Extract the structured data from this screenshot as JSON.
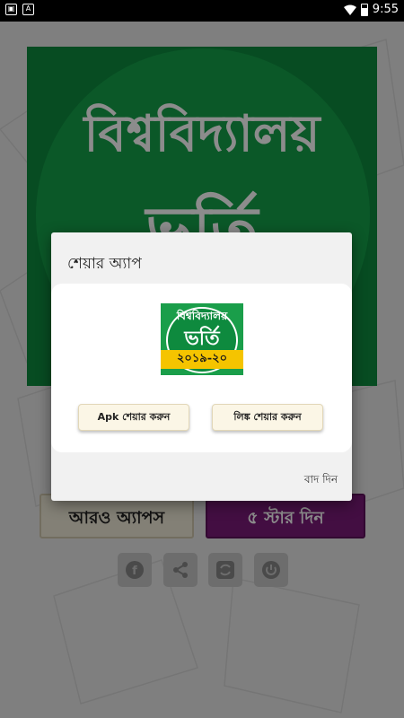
{
  "status_bar": {
    "time": "9:55",
    "left_icons": [
      "image-icon",
      "a-icon"
    ],
    "right_icons": [
      "wifi-icon",
      "battery-icon"
    ]
  },
  "background": {
    "hero_title": "বিশ্ববিদ্যালয়",
    "hero_subtitle": "ভর্তি",
    "more_apps_label": "আরও অ্যাপস",
    "rate_label": "৫ স্টার দিন",
    "social_icons": [
      "facebook-icon",
      "share-icon",
      "refresh-icon",
      "power-icon"
    ],
    "colors": {
      "hero_green": "#15a04a",
      "rate_purple": "#7b1a78"
    }
  },
  "dialog": {
    "title": "শেয়ার অ্যাপ",
    "logo": {
      "line1": "বিশ্ববিদ্যালয়",
      "line2": "ভর্তি",
      "line3": "২০১৯-২০"
    },
    "apk_share_label": "Apk শেয়ার করুন",
    "link_share_label": "লিঙ্ক শেয়ার করুন",
    "dismiss_label": "বাদ দিন"
  }
}
